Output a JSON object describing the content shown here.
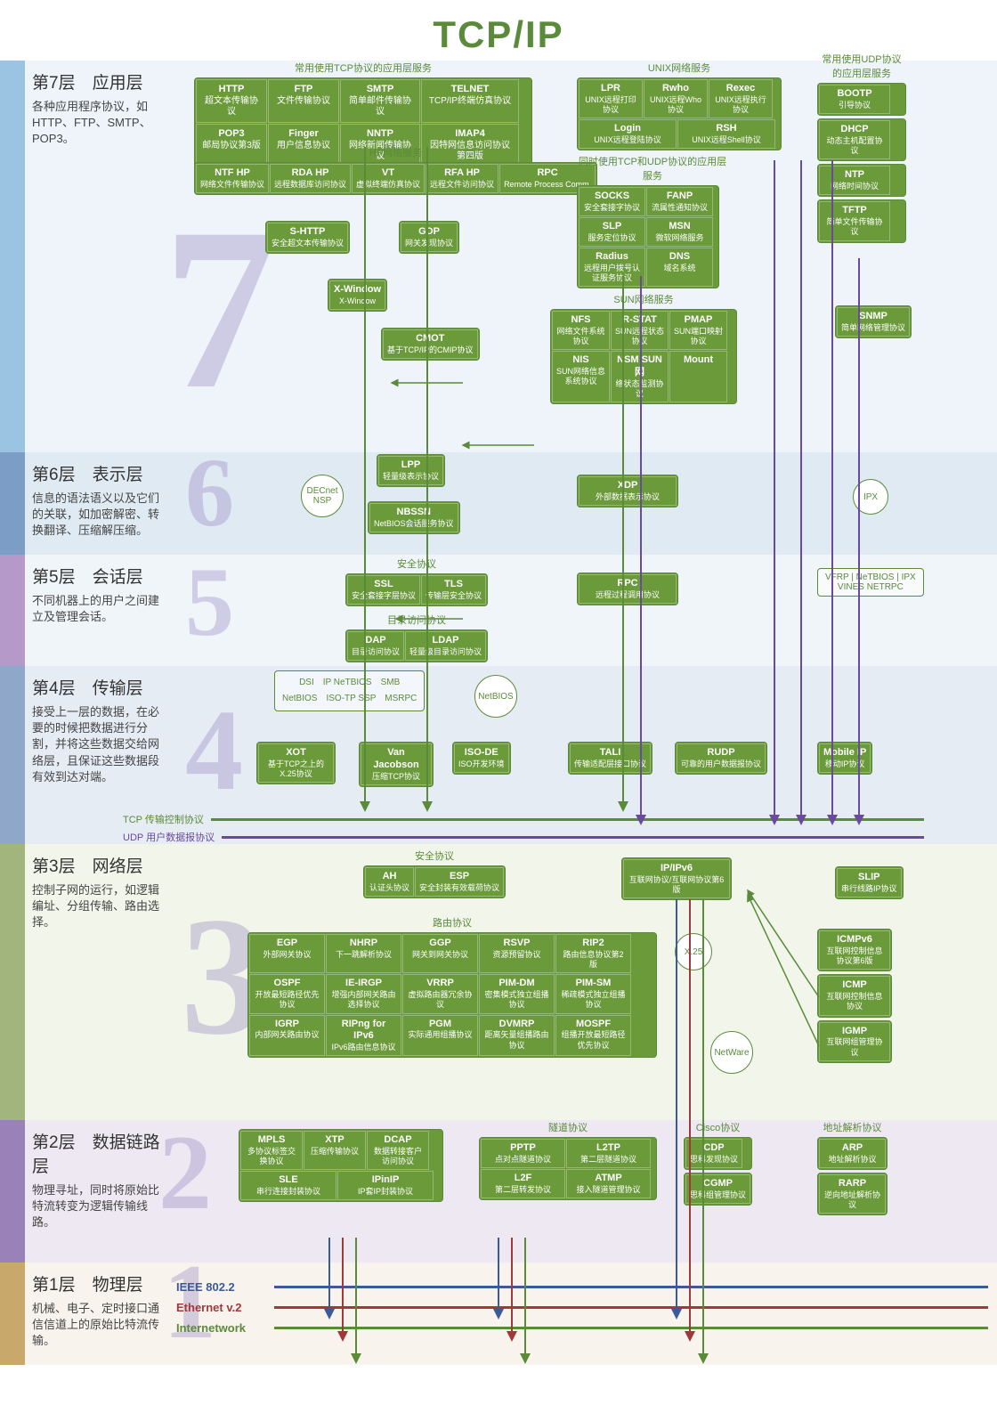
{
  "title": "TCP/IP",
  "layers": {
    "l7": {
      "name": "第7层　应用层",
      "desc": "各种应用程序协议，如HTTP、FTP、SMTP、POP3。"
    },
    "l6": {
      "name": "第6层　表示层",
      "desc": "信息的语法语义以及它们的关联，如加密解密、转换翻译、压缩解压缩。"
    },
    "l5": {
      "name": "第5层　会话层",
      "desc": "不同机器上的用户之间建立及管理会话。"
    },
    "l4": {
      "name": "第4层　传输层",
      "desc": "接受上一层的数据，在必要的时候把数据进行分割，并将这些数据交给网络层，且保证这些数据段有效到达对端。"
    },
    "l3": {
      "name": "第3层　网络层",
      "desc": "控制子网的运行，如逻辑编址、分组传输、路由选择。"
    },
    "l2": {
      "name": "第2层　数据链路层",
      "desc": "物理寻址，同时将原始比特流转变为逻辑传输线路。"
    },
    "l1": {
      "name": "第1层　物理层",
      "desc": "机械、电子、定时接口通信信道上的原始比特流传输。"
    }
  },
  "group_labels": {
    "tcp_app": "常用使用TCP协议的应用层服务",
    "unix": "UNIX网络服务",
    "udp_app": "常用使用UDP协议的应用层服务",
    "hp": "HP网络服务",
    "both": "同时使用TCP和UDP协议的应用层服务",
    "sun": "SUN网络服务",
    "security": "安全协议",
    "dir": "目录访问协议",
    "sec3": "安全协议",
    "routing": "路由协议",
    "tunnel": "隧道协议",
    "cisco": "Cisco协议",
    "addr": "地址解析协议",
    "tcp_line": "TCP 传输控制协议",
    "udp_line": "UDP 用户数据报协议"
  },
  "protocols": {
    "http": {
      "t": "HTTP",
      "d": "超文本传输协议"
    },
    "ftp": {
      "t": "FTP",
      "d": "文件传输协议"
    },
    "smtp": {
      "t": "SMTP",
      "d": "简单邮件传输协议"
    },
    "telnet": {
      "t": "TELNET",
      "d": "TCP/IP终端仿真协议"
    },
    "pop3": {
      "t": "POP3",
      "d": "邮局协议第3版"
    },
    "finger": {
      "t": "Finger",
      "d": "用户信息协议"
    },
    "nntp": {
      "t": "NNTP",
      "d": "网络新闻传输协议"
    },
    "imap4": {
      "t": "IMAP4",
      "d": "因特网信息访问协议第四版"
    },
    "lpr": {
      "t": "LPR",
      "d": "UNIX远程打印协议"
    },
    "rwho": {
      "t": "Rwho",
      "d": "UNIX远程Who协议"
    },
    "rexec": {
      "t": "Rexec",
      "d": "UNIX远程执行协议"
    },
    "login": {
      "t": "Login",
      "d": "UNIX远程登陆协议"
    },
    "rsh": {
      "t": "RSH",
      "d": "UNIX远程Shell协议"
    },
    "bootp": {
      "t": "BOOTP",
      "d": "引导协议"
    },
    "dhcp": {
      "t": "DHCP",
      "d": "动态主机配置协议"
    },
    "ntp": {
      "t": "NTP",
      "d": "网络时间协议"
    },
    "tftp": {
      "t": "TFTP",
      "d": "简单文件传输协议"
    },
    "ntfhp": {
      "t": "NTF HP",
      "d": "网络文件传输协议"
    },
    "rdahp": {
      "t": "RDA HP",
      "d": "远程数据库访问协议"
    },
    "vt": {
      "t": "VT",
      "d": "虚拟终端仿真协议"
    },
    "rfahp": {
      "t": "RFA HP",
      "d": "远程文件访问协议"
    },
    "rpc_hp": {
      "t": "RPC",
      "d": "Remote Process Comm."
    },
    "socks": {
      "t": "SOCKS",
      "d": "安全套接字协议"
    },
    "fanp": {
      "t": "FANP",
      "d": "流属性通知协议"
    },
    "slp": {
      "t": "SLP",
      "d": "服务定位协议"
    },
    "msn": {
      "t": "MSN",
      "d": "微软网络服务"
    },
    "radius": {
      "t": "Radius",
      "d": "远程用户拨号认证服务协议"
    },
    "dns": {
      "t": "DNS",
      "d": "域名系统"
    },
    "shttp": {
      "t": "S-HTTP",
      "d": "安全超文本传输协议"
    },
    "gdp": {
      "t": "GDP",
      "d": "网关发现协议"
    },
    "xwin": {
      "t": "X-Window",
      "d": "X-Window"
    },
    "cmot": {
      "t": "CMOT",
      "d": "基于TCP/IP的CMIP协议"
    },
    "nfs": {
      "t": "NFS",
      "d": "网络文件系统协议"
    },
    "rstat": {
      "t": "R-STAT",
      "d": "SUN远程状态协议"
    },
    "pmap": {
      "t": "PMAP",
      "d": "SUN端口映射协议"
    },
    "nis": {
      "t": "NIS",
      "d": "SUN网络信息系统协议"
    },
    "nsm": {
      "t": "NSM SUN网",
      "d": "络状态监测协议"
    },
    "mount": {
      "t": "Mount",
      "d": ""
    },
    "snmp": {
      "t": "SNMP",
      "d": "简单网络管理协议"
    },
    "decnet": "DECnet NSP",
    "lpp": {
      "t": "LPP",
      "d": "轻量级表示协议"
    },
    "nbssn": {
      "t": "NBSSN",
      "d": "NetBIOS会话服务协议"
    },
    "xdp": {
      "t": "XDP",
      "d": "外部数据表示协议"
    },
    "ipx": "IPX",
    "ssl": {
      "t": "SSL",
      "d": "安全套接字层协议"
    },
    "tls": {
      "t": "TLS",
      "d": "传输层安全协议"
    },
    "dap": {
      "t": "DAP",
      "d": "目录访问协议"
    },
    "ldap": {
      "t": "LDAP",
      "d": "轻量级目录访问协议"
    },
    "rpc5": {
      "t": "RPC",
      "d": "远程过程调用协议"
    },
    "vfrp": "VFRP",
    "netbios5": "NeTBIOS",
    "ipx5": "IPX",
    "vines": "VINES NETRPC",
    "dsi": "DSI",
    "ipnb": "IP NeTBIOS",
    "smb": "SMB",
    "netbios4": "NetBIOS",
    "isotp": "ISO-TP SSP",
    "msrpc": "MSRPC",
    "netbios_c": "NetBIOS",
    "xot": {
      "t": "XOT",
      "d": "基于TCP之上的X.25协议"
    },
    "vanj": {
      "t": "Van Jacobson",
      "d": "压缩TCP协议"
    },
    "isode": {
      "t": "ISO-DE",
      "d": "ISO开发环境"
    },
    "tali": {
      "t": "TALI",
      "d": "传输适配层接口协议"
    },
    "rudp": {
      "t": "RUDP",
      "d": "可靠的用户数据报协议"
    },
    "mobileip": {
      "t": "Mobile IP",
      "d": "移动IP协议"
    },
    "ah": {
      "t": "AH",
      "d": "认证头协议"
    },
    "esp": {
      "t": "ESP",
      "d": "安全封装有效载荷协议"
    },
    "ipipv6": {
      "t": "IP/IPv6",
      "d": "互联网协议/互联网协议第6版"
    },
    "slip": {
      "t": "SLIP",
      "d": "串行线路IP协议"
    },
    "egp": {
      "t": "EGP",
      "d": "外部网关协议"
    },
    "nhrp": {
      "t": "NHRP",
      "d": "下一跳解析协议"
    },
    "ggp": {
      "t": "GGP",
      "d": "网关到网关协议"
    },
    "rsvp": {
      "t": "RSVP",
      "d": "资源预留协议"
    },
    "rip2": {
      "t": "RIP2",
      "d": "路由信息协议第2版"
    },
    "ospf": {
      "t": "OSPF",
      "d": "开放最短路径优先协议"
    },
    "ieirgp": {
      "t": "IE-IRGP",
      "d": "增强内部网关路由选择协议"
    },
    "vrrp": {
      "t": "VRRP",
      "d": "虚拟路由器冗余协议"
    },
    "pimdm": {
      "t": "PIM-DM",
      "d": "密集模式独立组播协议"
    },
    "pimsm": {
      "t": "PIM-SM",
      "d": "稀疏模式独立组播协议"
    },
    "igrp": {
      "t": "IGRP",
      "d": "内部网关路由协议"
    },
    "ripng": {
      "t": "RIPng for IPv6",
      "d": "IPv6路由信息协议"
    },
    "pgm": {
      "t": "PGM",
      "d": "实际通用组播协议"
    },
    "dvmrp": {
      "t": "DVMRP",
      "d": "距离矢量组播路由协议"
    },
    "mospf": {
      "t": "MOSPF",
      "d": "组播开放最短路径优先协议"
    },
    "x25": "X.25",
    "netware": "NetWare",
    "icmpv6": {
      "t": "ICMPv6",
      "d": "互联网控制信息协议第6版"
    },
    "icmp": {
      "t": "ICMP",
      "d": "互联网控制信息协议"
    },
    "igmp": {
      "t": "IGMP",
      "d": "互联网组管理协议"
    },
    "mpls": {
      "t": "MPLS",
      "d": "多协议标签交换协议"
    },
    "xtp": {
      "t": "XTP",
      "d": "压缩传输协议"
    },
    "dcap": {
      "t": "DCAP",
      "d": "数据转接客户访问协议"
    },
    "sle": {
      "t": "SLE",
      "d": "串行连接封装协议"
    },
    "ipinip": {
      "t": "IPinIP",
      "d": "IP套IP封装协议"
    },
    "pptp": {
      "t": "PPTP",
      "d": "点对点隧道协议"
    },
    "l2tp": {
      "t": "L2TP",
      "d": "第二层隧道协议"
    },
    "l2f": {
      "t": "L2F",
      "d": "第二层转发协议"
    },
    "atmp": {
      "t": "ATMP",
      "d": "接入隧道管理协议"
    },
    "cdp": {
      "t": "CDP",
      "d": "思科发现协议"
    },
    "cgmp": {
      "t": "CGMP",
      "d": "思科组管理协议"
    },
    "arp": {
      "t": "ARP",
      "d": "地址解析协议"
    },
    "rarp": {
      "t": "RARP",
      "d": "逆向地址解析协议"
    }
  },
  "phys": {
    "ieee": "IEEE 802.2",
    "eth": "Ethernet v.2",
    "inet": "Internetwork"
  }
}
